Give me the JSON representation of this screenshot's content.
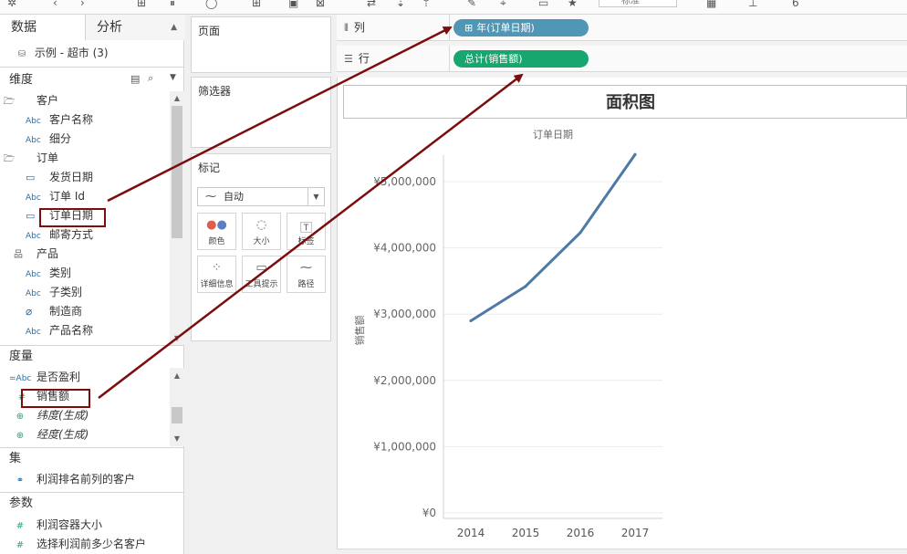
{
  "left_pane": {
    "tabs": [
      {
        "label": "数据",
        "active": true
      },
      {
        "label": "分析",
        "active": false
      }
    ],
    "datasource": {
      "label": "示例 - 超市 (3)"
    },
    "dimensions_header": "维度",
    "dimensions": [
      {
        "label": "客户",
        "kind": "folder"
      },
      {
        "label": "客户名称",
        "kind": "abc"
      },
      {
        "label": "细分",
        "kind": "abc"
      },
      {
        "label": "订单",
        "kind": "folder"
      },
      {
        "label": "发货日期",
        "kind": "date"
      },
      {
        "label": "订单 Id",
        "kind": "abc"
      },
      {
        "label": "订单日期",
        "kind": "date",
        "highlighted": true
      },
      {
        "label": "邮寄方式",
        "kind": "abc"
      },
      {
        "label": "产品",
        "kind": "hierarchy"
      },
      {
        "label": "类别",
        "kind": "abc"
      },
      {
        "label": "子类别",
        "kind": "abc"
      },
      {
        "label": "制造商",
        "kind": "link"
      },
      {
        "label": "产品名称",
        "kind": "abc"
      }
    ],
    "measures_header": "度量",
    "measures": [
      {
        "label": "是否盈利",
        "kind": "calc-abc"
      },
      {
        "label": "销售额",
        "kind": "number",
        "highlighted": true
      },
      {
        "label": "纬度(生成)",
        "kind": "geo",
        "italic": true
      },
      {
        "label": "经度(生成)",
        "kind": "geo",
        "italic": true
      }
    ],
    "sets_header": "集",
    "sets": [
      {
        "label": "利润排名前列的客户"
      }
    ],
    "params_header": "参数",
    "params": [
      {
        "label": "利润容器大小"
      },
      {
        "label": "选择利润前多少名客户"
      }
    ],
    "type_abc": "Abc",
    "type_calc_abc": "=Abc"
  },
  "toolbar": {
    "selector_text": "标准"
  },
  "cards": {
    "pages_title": "页面",
    "filters_title": "筛选器",
    "marks_title": "标记",
    "mark_type": "自动",
    "mark_buttons": [
      {
        "label": "颜色",
        "icon": "color-dots-icon"
      },
      {
        "label": "大小",
        "icon": "size-icon"
      },
      {
        "label": "标签",
        "icon": "label-icon"
      },
      {
        "label": "详细信息",
        "icon": "detail-icon"
      },
      {
        "label": "工具提示",
        "icon": "tooltip-icon"
      },
      {
        "label": "路径",
        "icon": "path-icon"
      }
    ]
  },
  "shelves": {
    "columns": {
      "label": "列",
      "pill": "年(订单日期)",
      "pill_color": "#4f97b5"
    },
    "rows": {
      "label": "行",
      "pill": "总计(销售额)",
      "pill_color": "#18a66f"
    }
  },
  "view": {
    "title": "面积图",
    "x_header": "订单日期"
  },
  "chart_data": {
    "type": "line",
    "title": "面积图",
    "xlabel": "订单日期",
    "ylabel": "销售额",
    "categories": [
      "2014",
      "2015",
      "2016",
      "2017"
    ],
    "series": [
      {
        "values": [
          2900000,
          3420000,
          4230000,
          5410000
        ],
        "color": "#4e79a7"
      }
    ],
    "ylim": [
      0,
      5500000
    ],
    "yticks": [
      {
        "value": 0,
        "label": "¥0"
      },
      {
        "value": 1000000,
        "label": "¥1,000,000"
      },
      {
        "value": 2000000,
        "label": "¥2,000,000"
      },
      {
        "value": 3000000,
        "label": "¥3,000,000"
      },
      {
        "value": 4000000,
        "label": "¥4,000,000"
      },
      {
        "value": 5000000,
        "label": "¥5,000,000"
      }
    ],
    "grid": true
  },
  "annotations": {
    "arrow_color": "#7b0d0d"
  }
}
